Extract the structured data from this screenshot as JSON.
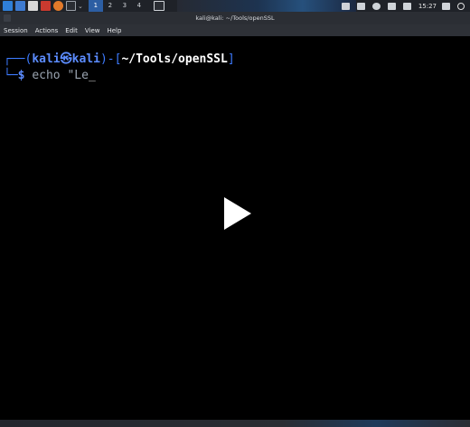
{
  "taskbar": {
    "workspaces": [
      "1",
      "2",
      "3",
      "4"
    ],
    "active_workspace": "1",
    "clock": "15:27",
    "icons": [
      "kali-menu-icon",
      "show-desktop-icon",
      "file-manager-icon",
      "text-editor-icon",
      "firefox-icon",
      "terminal-icon",
      "chevron-down-icon",
      "terminal-window-icon",
      "screen-icon",
      "tray-icon",
      "network-icon",
      "notification-bell-icon",
      "speaker-icon",
      "lock-icon",
      "power-icon"
    ]
  },
  "window": {
    "title": "kali@kali: ~/Tools/openSSL"
  },
  "menu": {
    "items": [
      "Session",
      "Actions",
      "Edit",
      "View",
      "Help"
    ]
  },
  "terminal": {
    "prompt": {
      "corner_top": "┌──(",
      "user": "kali",
      "at": "㉿",
      "host": "kali",
      "sep": ")-[",
      "path": "~/Tools/openSSL",
      "close": "]",
      "corner_bottom": "└─",
      "dollar": "$"
    },
    "input": "echo \"Le",
    "cursor": "_"
  },
  "colors": {
    "prompt_blue": "#3d7bff",
    "path_white": "#ffffff",
    "workspace_active": "#2c5ea3"
  }
}
